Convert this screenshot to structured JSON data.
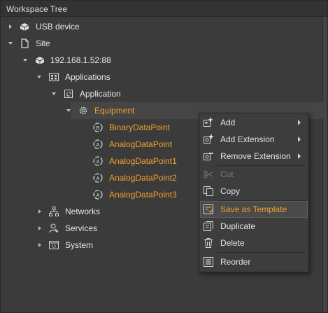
{
  "panel": {
    "title": "Workspace Tree"
  },
  "tree": {
    "usb_device": "USB device",
    "site": "Site",
    "device_ip": "192.168.1.52:88",
    "applications": "Applications",
    "application": "Application",
    "equipment": "Equipment",
    "points": [
      "BinaryDataPoint",
      "AnalogDataPoint",
      "AnalogDataPoint1",
      "AnalogDataPoint2",
      "AnalogDataPoint3"
    ],
    "networks": "Networks",
    "services": "Services",
    "system": "System"
  },
  "context_menu": {
    "add": "Add",
    "add_extension": "Add Extension",
    "remove_extension": "Remove Extension",
    "cut": "Cut",
    "copy": "Copy",
    "save_as_template": "Save as Template",
    "duplicate": "Duplicate",
    "delete": "Delete",
    "reorder": "Reorder"
  },
  "colors": {
    "background": "#3b3b3b",
    "highlight_text": "#f0a030",
    "text": "#e6e6e6"
  }
}
